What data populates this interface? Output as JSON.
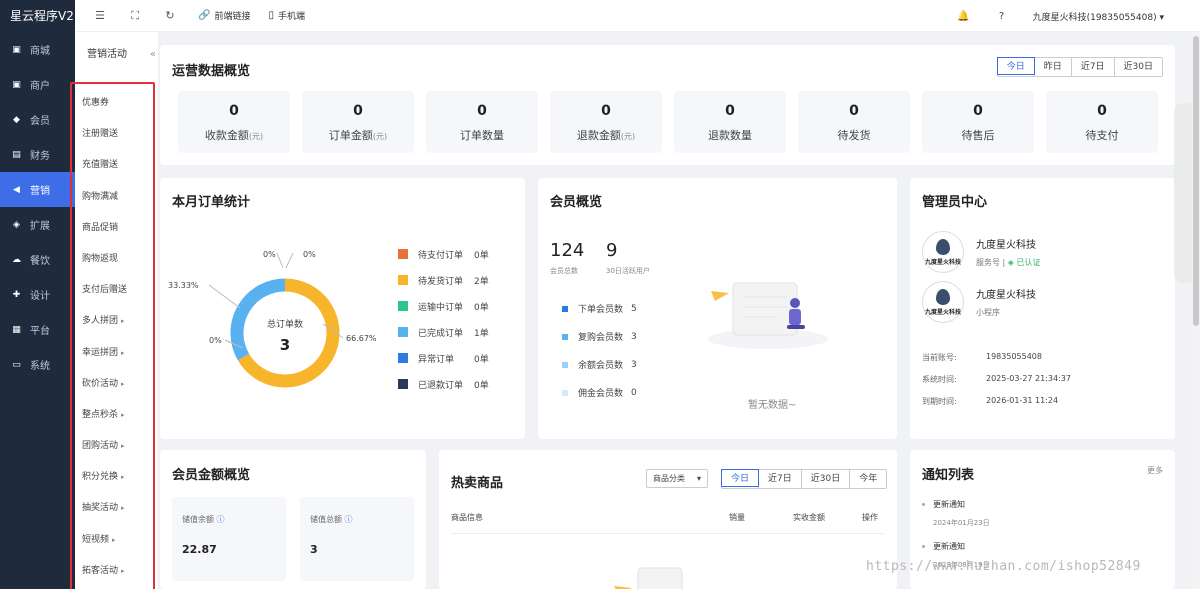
{
  "brand": "星云程序V2",
  "nav": [
    {
      "label": "商城",
      "icon": "store-icon",
      "glyph": "▣"
    },
    {
      "label": "商户",
      "icon": "merchant-icon",
      "glyph": "▣"
    },
    {
      "label": "会员",
      "icon": "member-icon",
      "glyph": "◆"
    },
    {
      "label": "财务",
      "icon": "finance-icon",
      "glyph": "▤"
    },
    {
      "label": "营销",
      "icon": "megaphone-icon",
      "glyph": "◀"
    },
    {
      "label": "扩展",
      "icon": "cube-icon",
      "glyph": "◈"
    },
    {
      "label": "餐饮",
      "icon": "cloud-icon",
      "glyph": "☁"
    },
    {
      "label": "设计",
      "icon": "puzzle-icon",
      "glyph": "✚"
    },
    {
      "label": "平台",
      "icon": "grid-icon",
      "glyph": "▦"
    },
    {
      "label": "系统",
      "icon": "monitor-icon",
      "glyph": "▭"
    }
  ],
  "active_nav": 4,
  "subnav": {
    "title": "营销活动",
    "items": [
      {
        "label": "优惠券",
        "sub": false
      },
      {
        "label": "注册赠送",
        "sub": false
      },
      {
        "label": "充值赠送",
        "sub": false
      },
      {
        "label": "购物满减",
        "sub": false
      },
      {
        "label": "商品促销",
        "sub": false
      },
      {
        "label": "购物返现",
        "sub": false
      },
      {
        "label": "支付后赠送",
        "sub": false
      },
      {
        "label": "多人拼团",
        "sub": true
      },
      {
        "label": "幸运拼团",
        "sub": true
      },
      {
        "label": "砍价活动",
        "sub": true
      },
      {
        "label": "整点秒杀",
        "sub": true
      },
      {
        "label": "团购活动",
        "sub": true
      },
      {
        "label": "积分兑换",
        "sub": true
      },
      {
        "label": "抽奖活动",
        "sub": true
      },
      {
        "label": "短视频",
        "sub": true
      },
      {
        "label": "拓客活动",
        "sub": true
      }
    ]
  },
  "topbar": {
    "frontend_link": "前端链接",
    "mobile": "手机端",
    "user": "九度星火科技(19835055408)"
  },
  "ops": {
    "title": "运营数据概览",
    "ranges": [
      "今日",
      "昨日",
      "近7日",
      "近30日"
    ],
    "active_range": 0,
    "stats": [
      {
        "value": "0",
        "label": "收款金额",
        "unit": "(元)"
      },
      {
        "value": "0",
        "label": "订单金额",
        "unit": "(元)"
      },
      {
        "value": "0",
        "label": "订单数量",
        "unit": ""
      },
      {
        "value": "0",
        "label": "退款金额",
        "unit": "(元)"
      },
      {
        "value": "0",
        "label": "退款数量",
        "unit": ""
      },
      {
        "value": "0",
        "label": "待发货",
        "unit": ""
      },
      {
        "value": "0",
        "label": "待售后",
        "unit": ""
      },
      {
        "value": "0",
        "label": "待支付",
        "unit": ""
      }
    ]
  },
  "month_orders": {
    "title": "本月订单统计",
    "center_label": "总订单数",
    "center_value": "3",
    "slice_labels": [
      "0%",
      "0%",
      "33.33%",
      "0%",
      "66.67%"
    ],
    "legend": [
      {
        "name": "待支付订单",
        "count": "0单",
        "color": "#e8723a"
      },
      {
        "name": "待发货订单",
        "count": "2单",
        "color": "#f7b52c"
      },
      {
        "name": "运输中订单",
        "count": "0单",
        "color": "#2dc78b"
      },
      {
        "name": "已完成订单",
        "count": "1单",
        "color": "#5ab1ef"
      },
      {
        "name": "异常订单",
        "count": "0单",
        "color": "#2d7be0"
      },
      {
        "name": "已退款订单",
        "count": "0单",
        "color": "#2b3a5a"
      }
    ]
  },
  "chart_data": {
    "type": "pie",
    "center_label": "总订单数",
    "center_value": 3,
    "categories": [
      "待支付订单",
      "待发货订单",
      "运输中订单",
      "已完成订单",
      "异常订单",
      "已退款订单"
    ],
    "values": [
      0,
      2,
      0,
      1,
      0,
      0
    ],
    "percent_labels": [
      "0%",
      "66.67%",
      "0%",
      "33.33%",
      "0%",
      "0%"
    ],
    "colors": [
      "#e8723a",
      "#f7b52c",
      "#2dc78b",
      "#5ab1ef",
      "#2d7be0",
      "#2b3a5a"
    ],
    "legend": "right"
  },
  "member": {
    "title": "会员概览",
    "total": "124",
    "total_label": "会员总数",
    "active": "9",
    "active_label": "30日活跃用户",
    "rows": [
      {
        "label": "下单会员数",
        "value": "5",
        "color": "#2d7be0"
      },
      {
        "label": "复购会员数",
        "value": "3",
        "color": "#5ab1ef"
      },
      {
        "label": "余额会员数",
        "value": "3",
        "color": "#9ccff5"
      },
      {
        "label": "佣金会员数",
        "value": "0",
        "color": "#d4e8f8"
      }
    ],
    "empty": "暂无数据~"
  },
  "admin": {
    "title": "管理员中心",
    "accounts": [
      {
        "name": "九度星火科技",
        "type": "服务号",
        "status": "已认证"
      },
      {
        "name": "九度星火科技",
        "type": "小程序",
        "status": ""
      }
    ],
    "logo_text": "九度星火科技",
    "info": [
      {
        "label": "当前账号:",
        "value": "19835055408"
      },
      {
        "label": "系统时间:",
        "value": "2025-03-27 21:34:37"
      },
      {
        "label": "到期时间:",
        "value": "2026-01-31 11:24"
      }
    ]
  },
  "money": {
    "title": "会员金额概览",
    "boxes": [
      {
        "label": "储值余额",
        "value": "22.87"
      },
      {
        "label": "储值总额",
        "value": "3"
      }
    ]
  },
  "hot": {
    "title": "热卖商品",
    "category": "商品分类",
    "ranges": [
      "今日",
      "近7日",
      "近30日",
      "今年"
    ],
    "active_range": 0,
    "columns": [
      "商品信息",
      "销量",
      "实收金额",
      "操作"
    ]
  },
  "notice": {
    "title": "通知列表",
    "more": "更多",
    "items": [
      {
        "title": "更新通知",
        "date": "2024年01月23日"
      },
      {
        "title": "更新通知",
        "date": "2023年08月19日"
      }
    ]
  },
  "watermark": "https://www.huzhan.com/ishop52849"
}
